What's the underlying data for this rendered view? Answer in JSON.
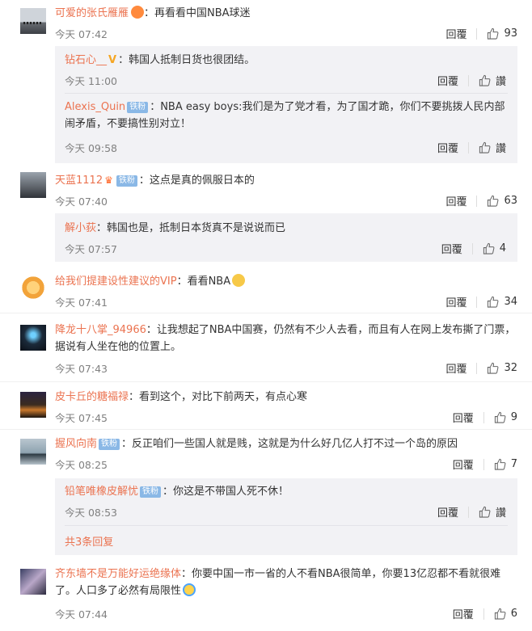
{
  "reply_label": "回覆",
  "like_zan_label": "讚",
  "badge_label": "铁粉",
  "comments": [
    {
      "name": "可爱的张氏雁雁",
      "text": "：再看看中国NBA球迷",
      "time": "今天 07:42",
      "likes": "93"
    },
    {
      "name": "天蓝1112",
      "text": "：这点是真的佩服日本的",
      "time": "今天 07:40",
      "likes": "63"
    },
    {
      "name": "给我们提建设性建议的VIP",
      "text": "：看看NBA",
      "time": "今天 07:41",
      "likes": "34"
    },
    {
      "name": "降龙十八掌_94966",
      "text": "：让我想起了NBA中国赛，仍然有不少人去看，而且有人在网上发布撕了门票，据说有人坐在他的位置上。",
      "time": "今天 07:43",
      "likes": "32"
    },
    {
      "name": "皮卡丘的糖福禄",
      "text": "：看到这个，对比下前两天，有点心寒",
      "time": "今天 07:45",
      "likes": "9"
    },
    {
      "name": "握风向南",
      "text": "：反正咱们一些国人就是贱，这就是为什么好几亿人打不过一个岛的原因",
      "time": "今天 08:25",
      "likes": "7"
    },
    {
      "name": "齐东墙不是万能好运绝缘体",
      "text": "：你要中国一市一省的人不看NBA很简单，你要13亿忍都不看就很难了。人口多了必然有局限性",
      "time": "今天 07:44",
      "likes": "6"
    }
  ],
  "replies": [
    {
      "name": "钻石心__",
      "text": "：韩国人抵制日货也很团结。",
      "time": "今天 11:00"
    },
    {
      "name": "Alexis_Quin",
      "text": "：NBA easy boys:我们是为了党才看，为了国才跪，你们不要挑拨人民内部闹矛盾，不要搞性别对立！",
      "time": "今天 09:58"
    },
    {
      "name": "解小荻",
      "text": "：韩国也是，抵制日本货真不是说说而已",
      "time": "今天 07:57",
      "likes": "4"
    },
    {
      "name": "铅笔唯橡皮解忧",
      "text": "：你这是不带国人死不休！",
      "time": "今天 08:53"
    }
  ],
  "more_replies": "共3条回复",
  "colors": {
    "name": "#eb7350",
    "badge": "#8ab8e6",
    "sub_bg": "#f2f2f5"
  }
}
